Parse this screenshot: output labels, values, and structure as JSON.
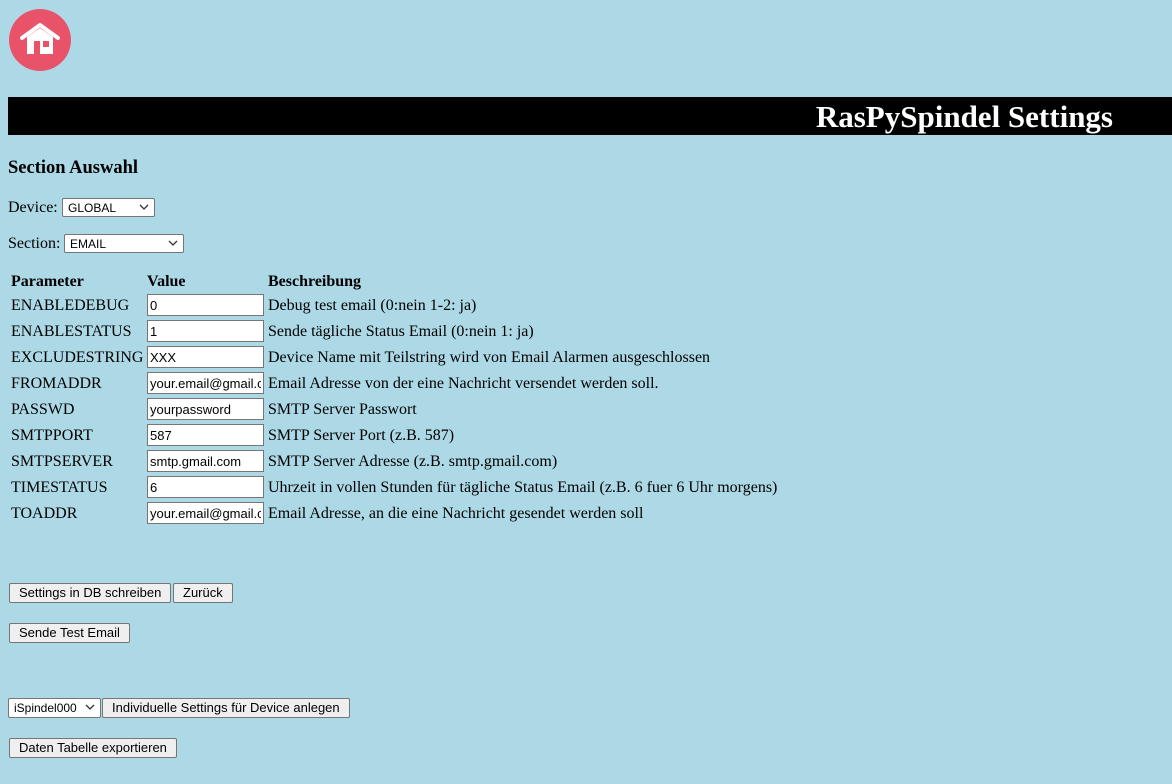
{
  "header": {
    "title": "RasPySpindel Settings",
    "home_icon": "home-icon"
  },
  "section_selection": {
    "heading": "Section Auswahl",
    "device_label": "Device:",
    "device_value": "GLOBAL",
    "section_label": "Section:",
    "section_value": "EMAIL"
  },
  "table": {
    "columns": [
      "Parameter",
      "Value",
      "Beschreibung"
    ],
    "rows": [
      {
        "parameter": "ENABLEDEBUG",
        "value": "0",
        "description": "Debug test email (0:nein 1-2: ja)"
      },
      {
        "parameter": "ENABLESTATUS",
        "value": "1",
        "description": "Sende tägliche Status Email (0:nein 1: ja)"
      },
      {
        "parameter": "EXCLUDESTRING",
        "value": "XXX",
        "description": "Device Name mit Teilstring wird von Email Alarmen ausgeschlossen"
      },
      {
        "parameter": "FROMADDR",
        "value": "your.email@gmail.com",
        "description": "Email Adresse von der eine Nachricht versendet werden soll."
      },
      {
        "parameter": "PASSWD",
        "value": "yourpassword",
        "description": "SMTP Server Passwort"
      },
      {
        "parameter": "SMTPPORT",
        "value": "587",
        "description": "SMTP Server Port (z.B. 587)"
      },
      {
        "parameter": "SMTPSERVER",
        "value": "smtp.gmail.com",
        "description": "SMTP Server Adresse (z.B. smtp.gmail.com)"
      },
      {
        "parameter": "TIMESTATUS",
        "value": "6",
        "description": "Uhrzeit in vollen Stunden für tägliche Status Email (z.B. 6 fuer 6 Uhr morgens)"
      },
      {
        "parameter": "TOADDR",
        "value": "your.email@gmail.com",
        "description": "Email Adresse, an die eine Nachricht gesendet werden soll"
      }
    ]
  },
  "buttons": {
    "write_db": "Settings in DB schreiben",
    "back": "Zurück",
    "test_email": "Sende Test Email",
    "device_select_value": "iSpindel000",
    "create_individual": "Individuelle Settings für Device anlegen",
    "export_table": "Daten Tabelle exportieren"
  }
}
